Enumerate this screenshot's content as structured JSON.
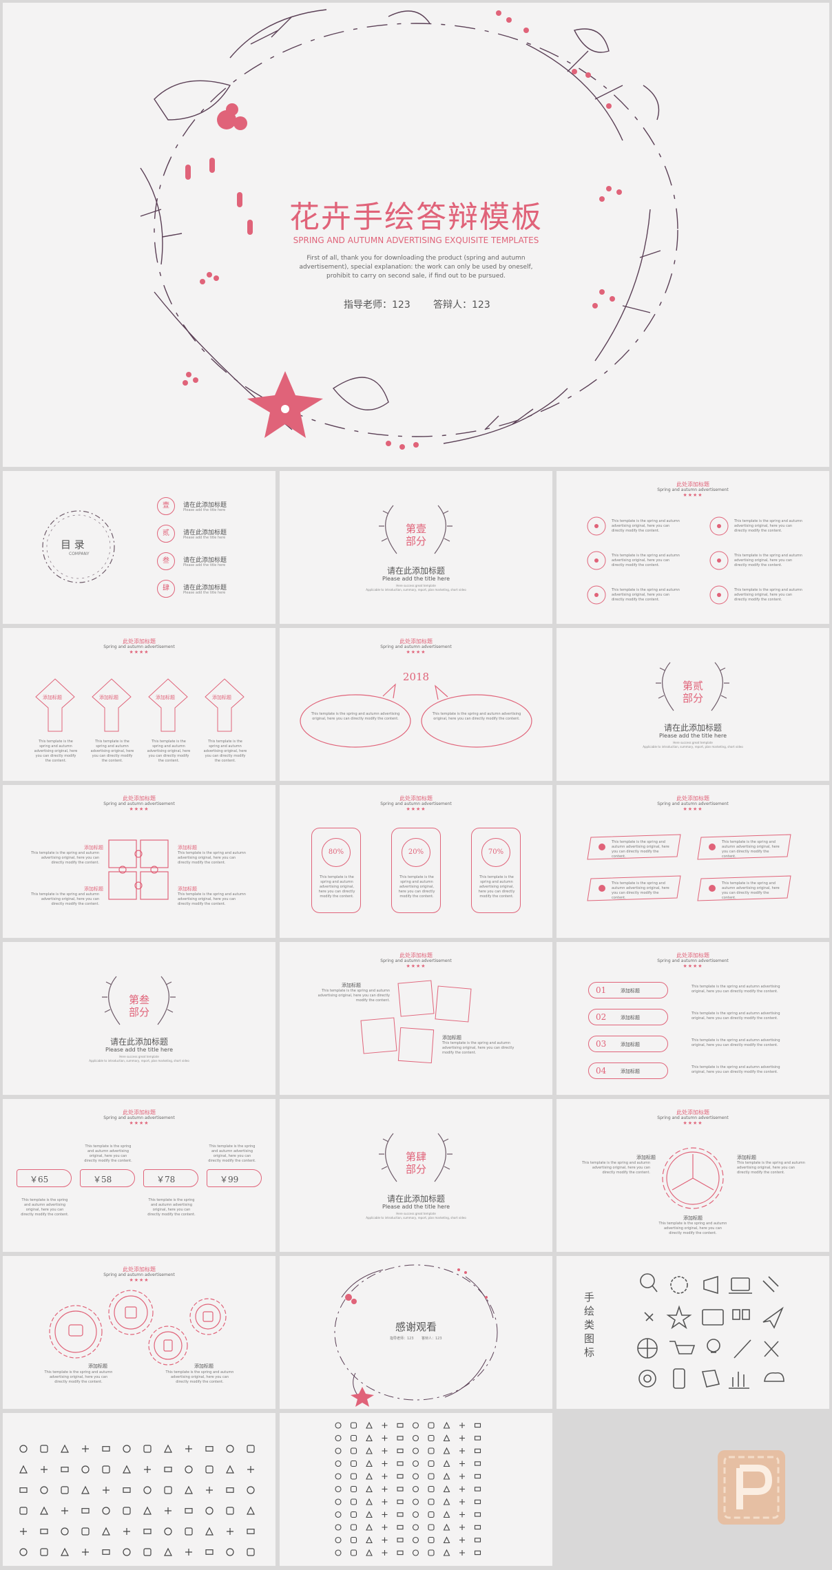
{
  "cover": {
    "title": "花卉手绘答辩模板",
    "subtitle": "SPRING AND AUTUMN ADVERTISING EXQUISITE TEMPLATES",
    "desc1": "First of all, thank you for downloading the product (spring and autumn",
    "desc2": "advertisement), special explanation: the work can only be used by oneself,",
    "desc3": "prohibit to carry on second sale, if find out to be pursued.",
    "advisor": "指导老师：123",
    "defender": "答辩人：123"
  },
  "common": {
    "header_title": "此处添加标题",
    "header_sub": "Spring and autumn advertisement",
    "stars": "★★★★",
    "add_title": "添加标题",
    "body": "This template is the spring and autumn advertising original, here you can directly modify the content.",
    "section_title": "请在此添加标题",
    "section_title_en": "Please add the title here",
    "section_tiny": "Here success great template",
    "section_tiny2": "Applicable to introduction, summary, report, plan marketing, short video"
  },
  "toc": {
    "title": "目  录",
    "title_en": "COMPANY",
    "items": [
      {
        "num": "壹",
        "label": "请在此添加标题",
        "sub": "Please add the title here"
      },
      {
        "num": "贰",
        "label": "请在此添加标题",
        "sub": "Please add the title here"
      },
      {
        "num": "叁",
        "label": "请在此添加标题",
        "sub": "Please add the title here"
      },
      {
        "num": "肆",
        "label": "请在此添加标题",
        "sub": "Please add the title here"
      }
    ]
  },
  "sections": [
    {
      "l1": "第壹",
      "l2": "部分"
    },
    {
      "l1": "第贰",
      "l2": "部分"
    },
    {
      "l1": "第叁",
      "l2": "部分"
    },
    {
      "l1": "第肆",
      "l2": "部分"
    }
  ],
  "year": "2018",
  "percents": [
    "80%",
    "20%",
    "70%"
  ],
  "nums": [
    "01",
    "02",
    "03",
    "04"
  ],
  "prices": [
    "￥65",
    "￥58",
    "￥78",
    "￥99"
  ],
  "thanks": {
    "title": "感谢观看",
    "advisor": "指导老师：123",
    "defender": "答辩人：123"
  },
  "icons_title": [
    "手",
    "绘",
    "类",
    "图",
    "标"
  ],
  "colors": {
    "accent": "#e06379",
    "bg": "#f4f3f3",
    "frame": "#d9d8d8"
  }
}
